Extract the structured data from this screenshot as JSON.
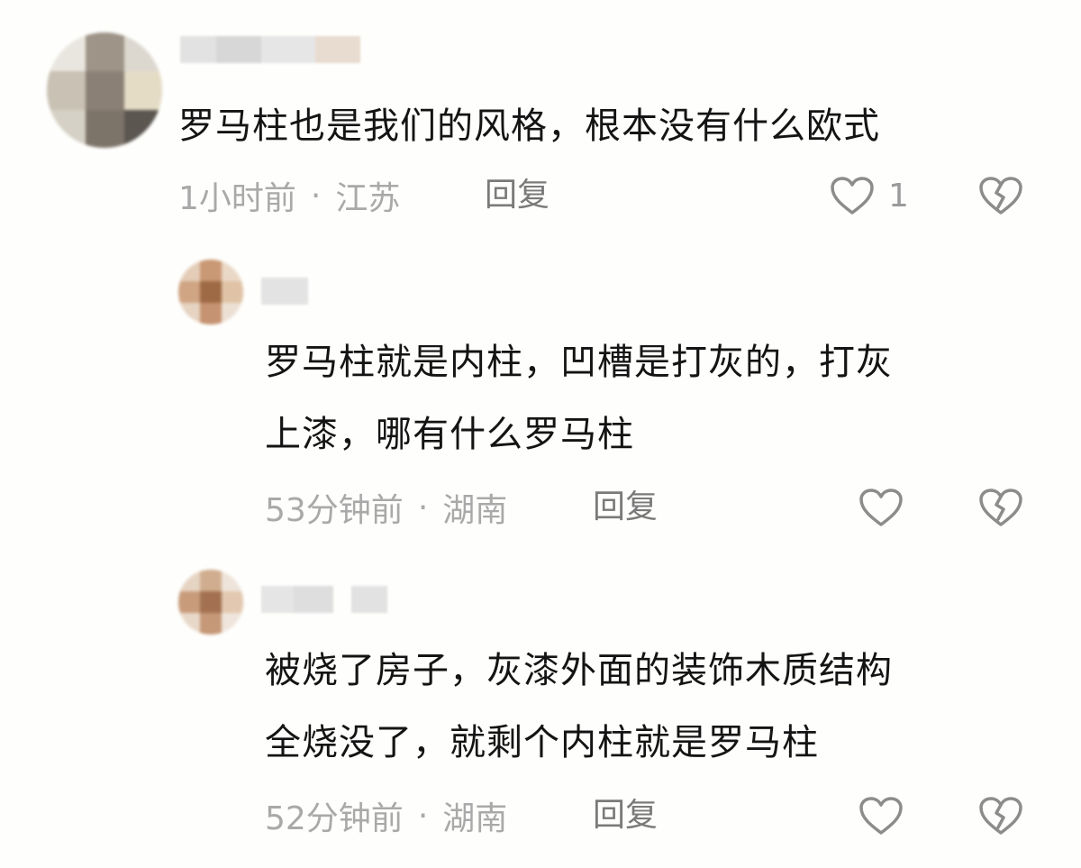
{
  "comments": [
    {
      "text_lines": [
        "罗马柱也是我们的风格，根本没有什么欧式"
      ],
      "time": "1小时前",
      "location": "江苏",
      "reply_label": "回复",
      "likes": "1"
    },
    {
      "text_lines": [
        "罗马柱就是内柱，凹槽是打灰的，打灰",
        "上漆，哪有什么罗马柱"
      ],
      "time": "53分钟前",
      "location": "湖南",
      "reply_label": "回复",
      "likes": ""
    },
    {
      "text_lines": [
        "被烧了房子，灰漆外面的装饰木质结构",
        "全烧没了，就剩个内柱就是罗马柱"
      ],
      "time": "52分钟前",
      "location": "湖南",
      "reply_label": "回复",
      "likes": ""
    }
  ],
  "meta_separator": "·",
  "colors": {
    "text": "#141414",
    "meta": "#a9a9a9",
    "reply": "#7a7a7a",
    "icon": "#8c8c8c"
  },
  "icons": {
    "like": "heart-outline-icon",
    "dislike": "broken-heart-icon"
  }
}
